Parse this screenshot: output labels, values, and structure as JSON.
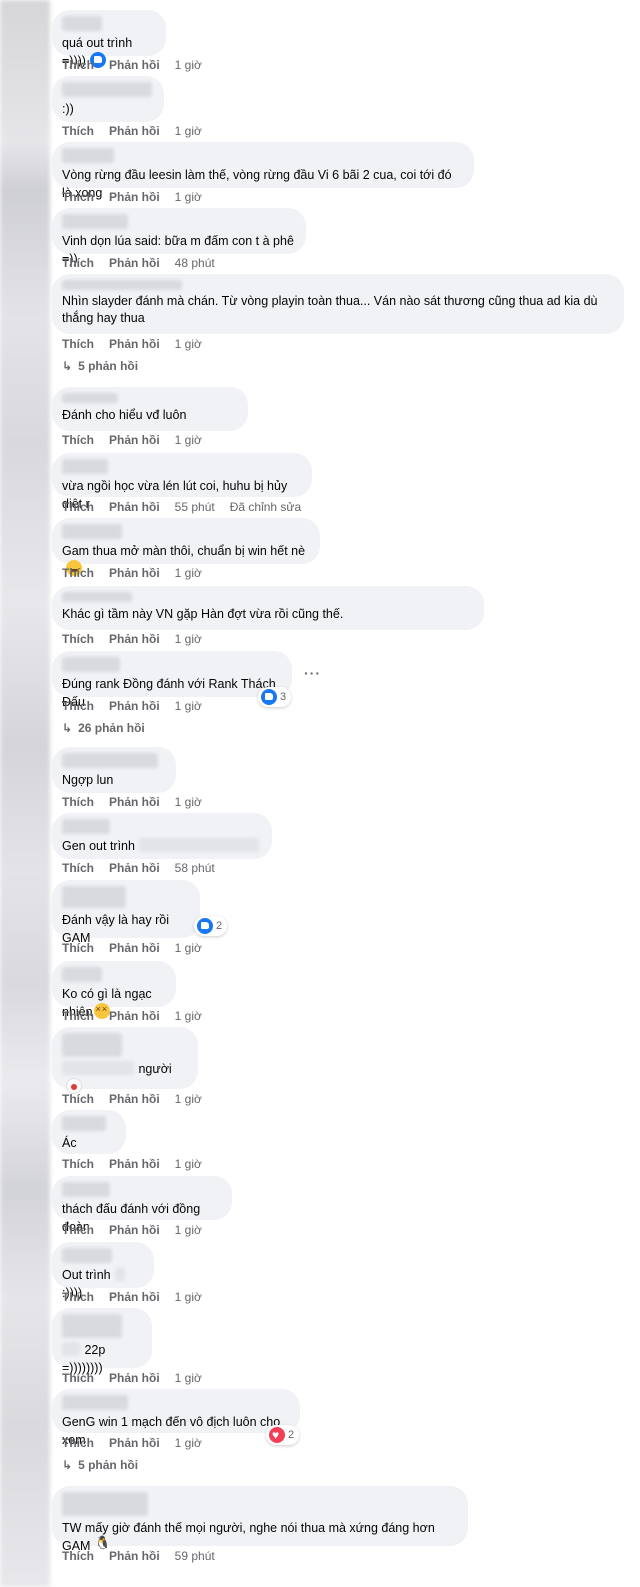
{
  "labels": {
    "like": "Thích",
    "reply": "Phản hồi",
    "edited": "Đã chỉnh sửa"
  },
  "comments": [
    {
      "text": "quá out trình =))))",
      "time": "1 giờ"
    },
    {
      "text": ":))",
      "time": "1 giờ"
    },
    {
      "text": "Vòng rừng đầu leesin làm thế, vòng rừng đầu Vi 6 bãi 2 cua, coi tới đó là xong",
      "time": "1 giờ"
    },
    {
      "text": "Vinh dọn lúa said: bữa m đấm con t à phê =))",
      "time": "48 phút"
    },
    {
      "text": "Nhìn slayder đánh mà chán. Từ vòng playin toàn thua... Ván nào sát thương cũng thua ad kia dù thắng hay thua",
      "time": "1 giờ",
      "replies": "5 phản hồi"
    },
    {
      "text": "Đánh cho hiểu vđ luôn",
      "time": "1 giờ"
    },
    {
      "text": "vừa ngồi học vừa lén lút coi, huhu bị hủy diệt r",
      "time": "55 phút"
    },
    {
      "text": "Gam thua mở màn thôi, chuẩn bị win hết nè",
      "time": "1 giờ"
    },
    {
      "text": "Khác gì tầm này VN gặp Hàn đợt vừa rồi cũng thế.",
      "time": "1 giờ"
    },
    {
      "text": "Đúng rank Đồng đánh với Rank Thách Đấu",
      "time": "1 giờ",
      "reactions": "3",
      "replies": "26 phản hồi"
    },
    {
      "text": "Ngợp lun",
      "time": "1 giờ"
    },
    {
      "text": "Gen out trình",
      "time": "58 phút"
    },
    {
      "text": "Đánh vậy là hay rồi GAM",
      "time": "1 giờ",
      "reactions": "2"
    },
    {
      "text": "Ko có gì là ngạc nhiên",
      "time": "1 giờ"
    },
    {
      "text": "người",
      "time": "1 giờ"
    },
    {
      "text": "Ác",
      "time": "1 giờ"
    },
    {
      "text": "thách đấu đánh với đồng đoàn",
      "time": "1 giờ"
    },
    {
      "text": "Out trình",
      "text2": ":))))",
      "time": "1 giờ"
    },
    {
      "text": "22p =))))))))",
      "time": "1 giờ"
    },
    {
      "text": "GenG win 1 mạch đến vô địch luôn cho xem",
      "time": "1 giờ",
      "reactions": "2",
      "replies": "5 phản hồi"
    },
    {
      "text": "TW mấy giờ đánh thế mọi người, nghe nói thua mà xứng đáng hơn GAM",
      "time": "59 phút"
    }
  ],
  "icons": {
    "like": "like-icon",
    "heart": "heart-icon",
    "reply_arrow": "reply-arrow-icon",
    "more": "more-options-icon"
  },
  "colors": {
    "bubble": "#f0f2f5",
    "meta": "#65676b",
    "like_blue": "#1877f2",
    "heart_red": "#f33e58"
  }
}
